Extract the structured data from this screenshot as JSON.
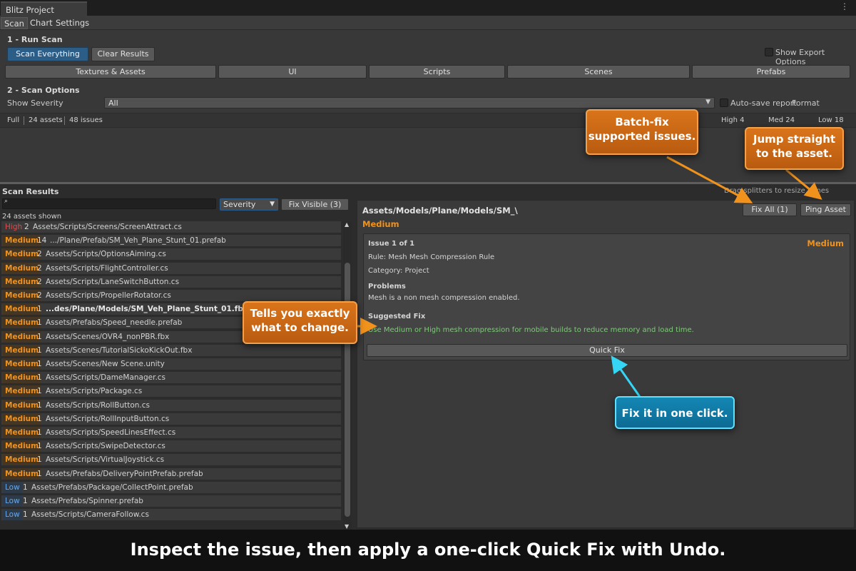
{
  "window": {
    "title": "Blitz Project Analyser",
    "menu_dots": "⋮"
  },
  "menu": {
    "scan": "Scan",
    "chart": "Chart",
    "settings": "Settings"
  },
  "run_scan": {
    "title": "1 - Run Scan",
    "scan_everything": "Scan Everything",
    "clear_results": "Clear Results",
    "show_export_options": "Show Export Options",
    "categories": [
      "Textures & Assets",
      "UI",
      "Scripts",
      "Scenes",
      "Prefabs"
    ]
  },
  "scan_options": {
    "title": "2 - Scan Options",
    "show_severity_label": "Show Severity",
    "show_severity_value": "All",
    "auto_save_report": "Auto-save report",
    "format_label": "Format"
  },
  "stats": {
    "mode": "Full",
    "assets": "24 assets",
    "issues": "48 issues",
    "high": "High 4",
    "med": "Med 24",
    "low": "Low 18"
  },
  "results": {
    "title": "Scan Results",
    "drag_hint": "Drag splitters to resize panes",
    "search_icon": "magnifier-icon",
    "severity_dropdown": "Severity",
    "fix_visible": "Fix Visible (3)",
    "shown_count": "24 assets shown",
    "rows": [
      {
        "sev": "High",
        "count": "2",
        "path": "Assets/Scripts/Screens/ScreenAttract.cs",
        "bold": false
      },
      {
        "sev": "Medium",
        "count": "14",
        "path": ".../Plane/Prefab/SM_Veh_Plane_Stunt_01.prefab",
        "bold": false
      },
      {
        "sev": "Medium",
        "count": "2",
        "path": "Assets/Scripts/OptionsAiming.cs",
        "bold": false
      },
      {
        "sev": "Medium",
        "count": "2",
        "path": "Assets/Scripts/FlightController.cs",
        "bold": false
      },
      {
        "sev": "Medium",
        "count": "2",
        "path": "Assets/Scripts/LaneSwitchButton.cs",
        "bold": false
      },
      {
        "sev": "Medium",
        "count": "2",
        "path": "Assets/Scripts/PropellerRotator.cs",
        "bold": false
      },
      {
        "sev": "Medium",
        "count": "1",
        "path": "...des/Plane/Models/SM_Veh_Plane_Stunt_01.fbx",
        "bold": true
      },
      {
        "sev": "Medium",
        "count": "1",
        "path": "Assets/Prefabs/Speed_needle.prefab",
        "bold": false
      },
      {
        "sev": "Medium",
        "count": "1",
        "path": "Assets/Scenes/OVR4_nonPBR.fbx",
        "bold": false
      },
      {
        "sev": "Medium",
        "count": "1",
        "path": "Assets/Scenes/TutorialSickoKickOut.fbx",
        "bold": false
      },
      {
        "sev": "Medium",
        "count": "1",
        "path": "Assets/Scenes/New Scene.unity",
        "bold": false
      },
      {
        "sev": "Medium",
        "count": "1",
        "path": "Assets/Scripts/DameManager.cs",
        "bold": false
      },
      {
        "sev": "Medium",
        "count": "1",
        "path": "Assets/Scripts/Package.cs",
        "bold": false
      },
      {
        "sev": "Medium",
        "count": "1",
        "path": "Assets/Scripts/RollButton.cs",
        "bold": false
      },
      {
        "sev": "Medium",
        "count": "1",
        "path": "Assets/Scripts/RollInputButton.cs",
        "bold": false
      },
      {
        "sev": "Medium",
        "count": "1",
        "path": "Assets/Scripts/SpeedLinesEffect.cs",
        "bold": false
      },
      {
        "sev": "Medium",
        "count": "1",
        "path": "Assets/Scripts/SwipeDetector.cs",
        "bold": false
      },
      {
        "sev": "Medium",
        "count": "1",
        "path": "Assets/Scripts/VirtualJoystick.cs",
        "bold": false
      },
      {
        "sev": "Medium",
        "count": "1",
        "path": "Assets/Prefabs/DeliveryPointPrefab.prefab",
        "bold": false
      },
      {
        "sev": "Low",
        "count": "1",
        "path": "Assets/Prefabs/Package/CollectPoint.prefab",
        "bold": false
      },
      {
        "sev": "Low",
        "count": "1",
        "path": "Assets/Prefabs/Spinner.prefab",
        "bold": false
      },
      {
        "sev": "Low",
        "count": "1",
        "path": "Assets/Scripts/CameraFollow.cs",
        "bold": false
      }
    ]
  },
  "detail": {
    "asset_path": "Assets/Models/Plane/Models/SM_\\",
    "asset_severity": "Medium",
    "fix_all": "Fix All (1)",
    "ping_asset": "Ping Asset",
    "issue_index": "Issue 1 of 1",
    "issue_severity": "Medium",
    "rule": "Rule: Mesh Mesh Compression Rule",
    "category": "Category: Project",
    "problems_label": "Problems",
    "problems_text": "Mesh is a non mesh compression enabled.",
    "suggested_fix_label": "Suggested Fix",
    "suggested_fix_text": "Use Medium or High mesh compression for mobile builds to reduce memory and load time.",
    "quick_fix": "Quick Fix"
  },
  "callouts": {
    "batch_fix": "Batch-fix\nsupported issues.",
    "jump": "Jump straight\nto the asset.",
    "tells": "Tells you exactly\nwhat to change.",
    "fix_one_click": "Fix it in one click."
  },
  "caption": "Inspect the issue, then apply a one-click Quick Fix with Undo.",
  "colors": {
    "high": "#e04b4b",
    "medium": "#f0921c",
    "low": "#6aa7e6",
    "callout_orange": "#c8661a",
    "callout_blue": "#1180ad",
    "fix_green": "#7fc97a"
  }
}
